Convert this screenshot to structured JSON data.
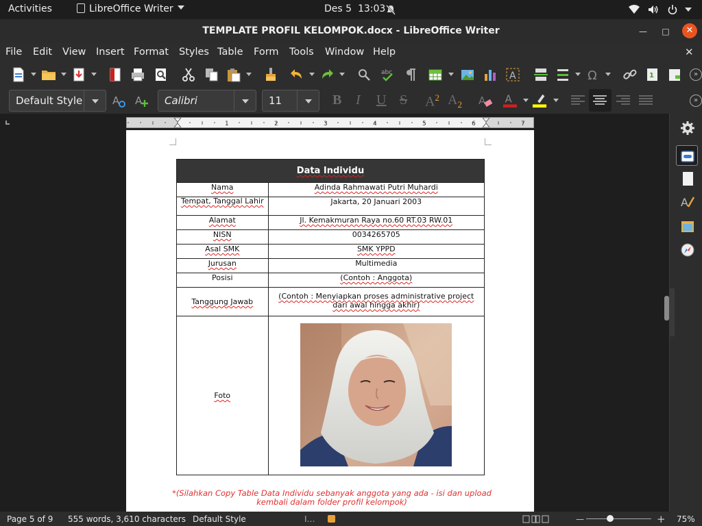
{
  "topbar": {
    "activities": "Activities",
    "app_name": "LibreOffice Writer",
    "date": "Des 5",
    "time": "13:03"
  },
  "window": {
    "title": "TEMPLATE PROFIL KELOMPOK.docx - LibreOffice Writer"
  },
  "menu": {
    "file": "File",
    "edit": "Edit",
    "view": "View",
    "insert": "Insert",
    "format": "Format",
    "styles": "Styles",
    "table": "Table",
    "form": "Form",
    "tools": "Tools",
    "window": "Window",
    "help": "Help"
  },
  "formatting": {
    "paragraph_style": "Default Style",
    "font_name": "Calibri",
    "font_size": "11",
    "bold": "B",
    "italic": "I",
    "underline": "U",
    "strikethrough": "S",
    "superscript": "A",
    "subscript": "A",
    "superscript_mark": "2",
    "subscript_mark": "2"
  },
  "ruler": {
    "marks": [
      "1",
      "2",
      "3",
      "4",
      "5",
      "6",
      "7"
    ]
  },
  "document": {
    "table_title": "Data Individu",
    "rows": [
      {
        "label": "Nama",
        "value": "Adinda Rahmawati Putri Muhardi"
      },
      {
        "label": "Tempat, Tanggal Lahir",
        "value": "Jakarta, 20 Januari 2003"
      },
      {
        "label": "Alamat",
        "value": "Jl. Kemakmuran Raya no.60 RT.03 RW.01"
      },
      {
        "label": "NISN",
        "value": "0034265705"
      },
      {
        "label": "Asal SMK",
        "value": "SMK YPPD"
      },
      {
        "label": "Jurusan",
        "value": "Multimedia"
      },
      {
        "label": "Posisi",
        "value": "(Contoh : Anggota)"
      },
      {
        "label": "Tanggung Jawab",
        "value": "(Contoh : Menyiapkan proses administrative project dari awal hingga akhir)"
      },
      {
        "label": "Foto",
        "value": ""
      }
    ],
    "footnote": "*(Silahkan Copy Table Data Individu sebanyak anggota yang ada - isi dan upload kembali dalam folder profil kelompok)"
  },
  "status": {
    "page": "Page 5 of 9",
    "words": "555 words, 3,610 characters",
    "style": "Default Style",
    "zoom": "75%"
  },
  "colors": {
    "accent": "#e95420",
    "header_cell": "#363636",
    "spelling": "#e02020",
    "footnote": "#e03030",
    "font_color_bar": "#c9211e",
    "highlight_bar": "#ffff00"
  }
}
